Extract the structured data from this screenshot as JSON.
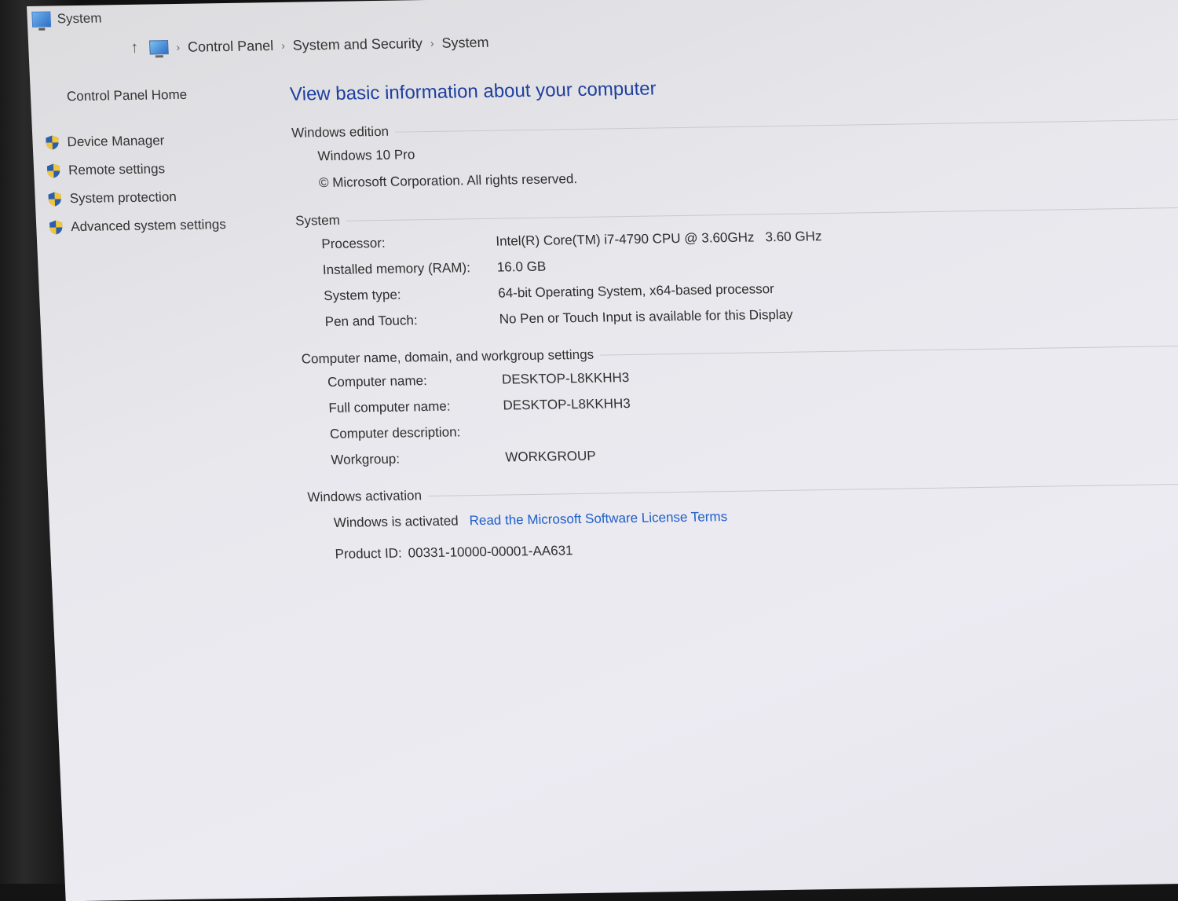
{
  "window": {
    "title": "System"
  },
  "breadcrumb": [
    "Control Panel",
    "System and Security",
    "System"
  ],
  "sidebar": {
    "home": "Control Panel Home",
    "items": [
      {
        "label": "Device Manager",
        "icon": "shield-icon"
      },
      {
        "label": "Remote settings",
        "icon": "shield-icon"
      },
      {
        "label": "System protection",
        "icon": "shield-icon"
      },
      {
        "label": "Advanced system settings",
        "icon": "shield-icon"
      }
    ]
  },
  "main": {
    "title": "View basic information about your computer",
    "edition": {
      "header": "Windows edition",
      "name": "Windows 10 Pro",
      "copyright": "© Microsoft Corporation. All rights reserved."
    },
    "system": {
      "header": "System",
      "rows": [
        {
          "label": "Processor:",
          "value": "Intel(R) Core(TM) i7-4790 CPU @ 3.60GHz   3.60 GHz"
        },
        {
          "label": "Installed memory (RAM):",
          "value": "16.0 GB"
        },
        {
          "label": "System type:",
          "value": "64-bit Operating System, x64-based processor"
        },
        {
          "label": "Pen and Touch:",
          "value": "No Pen or Touch Input is available for this Display"
        }
      ]
    },
    "computer": {
      "header": "Computer name, domain, and workgroup settings",
      "rows": [
        {
          "label": "Computer name:",
          "value": "DESKTOP-L8KKHH3"
        },
        {
          "label": "Full computer name:",
          "value": "DESKTOP-L8KKHH3"
        },
        {
          "label": "Computer description:",
          "value": ""
        },
        {
          "label": "Workgroup:",
          "value": "WORKGROUP"
        }
      ]
    },
    "activation": {
      "header": "Windows activation",
      "status": "Windows is activated",
      "license_link": "Read the Microsoft Software License Terms",
      "product_id_label": "Product ID:",
      "product_id": "00331-10000-00001-AA631"
    }
  },
  "colors": {
    "link": "#1f5fc9",
    "title": "#1e3f9e"
  }
}
